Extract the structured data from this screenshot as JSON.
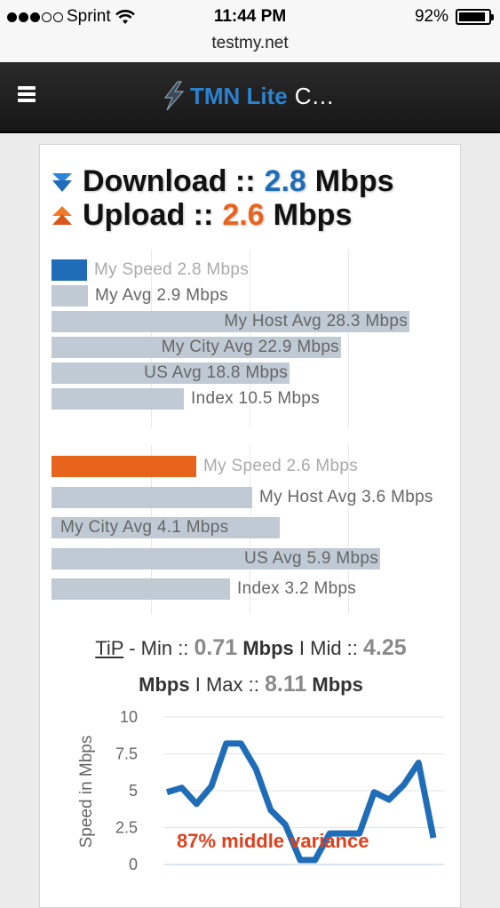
{
  "status": {
    "carrier": "Sprint",
    "time": "11:44 PM",
    "battery": "92%",
    "battery_level": 0.92,
    "signal_bars": 3,
    "signal_total": 5
  },
  "browser": {
    "url": "testmy.net"
  },
  "nav": {
    "brand_strong": "TMN Lite",
    "brand_rest": "C…"
  },
  "results": {
    "download_label": "Download ::",
    "download_value": "2.8",
    "download_unit": "Mbps",
    "upload_label": "Upload ::",
    "upload_value": "2.6",
    "upload_unit": "Mbps"
  },
  "colors": {
    "download": "#1f6db8",
    "upload": "#e8631c",
    "compare_bar": "#bfcad5",
    "variance_text": "#e0401c"
  },
  "chart_data": [
    {
      "type": "bar",
      "orientation": "horizontal",
      "categories": [
        "My Speed",
        "My Avg",
        "My Host Avg",
        "My City Avg",
        "US Avg",
        "Index"
      ],
      "values": [
        2.8,
        2.9,
        28.3,
        22.9,
        18.8,
        10.5
      ],
      "labels": [
        "My Speed 2.8 Mbps",
        "My Avg 2.9 Mbps",
        "My Host Avg 28.3 Mbps",
        "My City Avg 22.9 Mbps",
        "US Avg 18.8 Mbps",
        "Index 10.5 Mbps"
      ],
      "xlim": [
        0,
        29.5
      ]
    },
    {
      "type": "bar",
      "orientation": "horizontal",
      "categories": [
        "My Speed",
        "My Host Avg",
        "My City Avg",
        "US Avg",
        "Index"
      ],
      "values": [
        2.6,
        3.6,
        4.1,
        5.9,
        3.2
      ],
      "labels": [
        "My Speed 2.6 Mbps",
        "My Host Avg 3.6 Mbps",
        "My City Avg 4.1 Mbps",
        "US Avg 5.9 Mbps",
        "Index 3.2 Mbps"
      ],
      "xlim": [
        0,
        6.7
      ]
    },
    {
      "type": "line",
      "x": [
        1,
        2,
        3,
        4,
        5,
        6,
        7,
        8,
        9,
        10,
        11,
        12,
        13,
        14,
        15,
        16,
        17,
        18,
        19,
        20,
        21,
        22
      ],
      "values": [
        4.9,
        5.2,
        4.1,
        5.3,
        8.2,
        8.2,
        6.5,
        3.7,
        2.7,
        0.3,
        0.3,
        2.1,
        2.1,
        2.1,
        4.9,
        4.4,
        5.4,
        6.9,
        1.8
      ],
      "ylabel": "Speed in Mbps",
      "yticks": [
        "10",
        "7.5",
        "5",
        "2.5",
        "0"
      ],
      "ylim": [
        0,
        10
      ],
      "annotation": "87% middle variance"
    }
  ],
  "tip": {
    "link": "TiP",
    "sep1": " - Min :: ",
    "min": "0.71",
    "unit1": "Mbps",
    "sep2": " I Mid :: ",
    "mid": "4.25",
    "unit2": "Mbps",
    "sep3": " I Max :: ",
    "max": "8.11",
    "unit3": "Mbps"
  }
}
